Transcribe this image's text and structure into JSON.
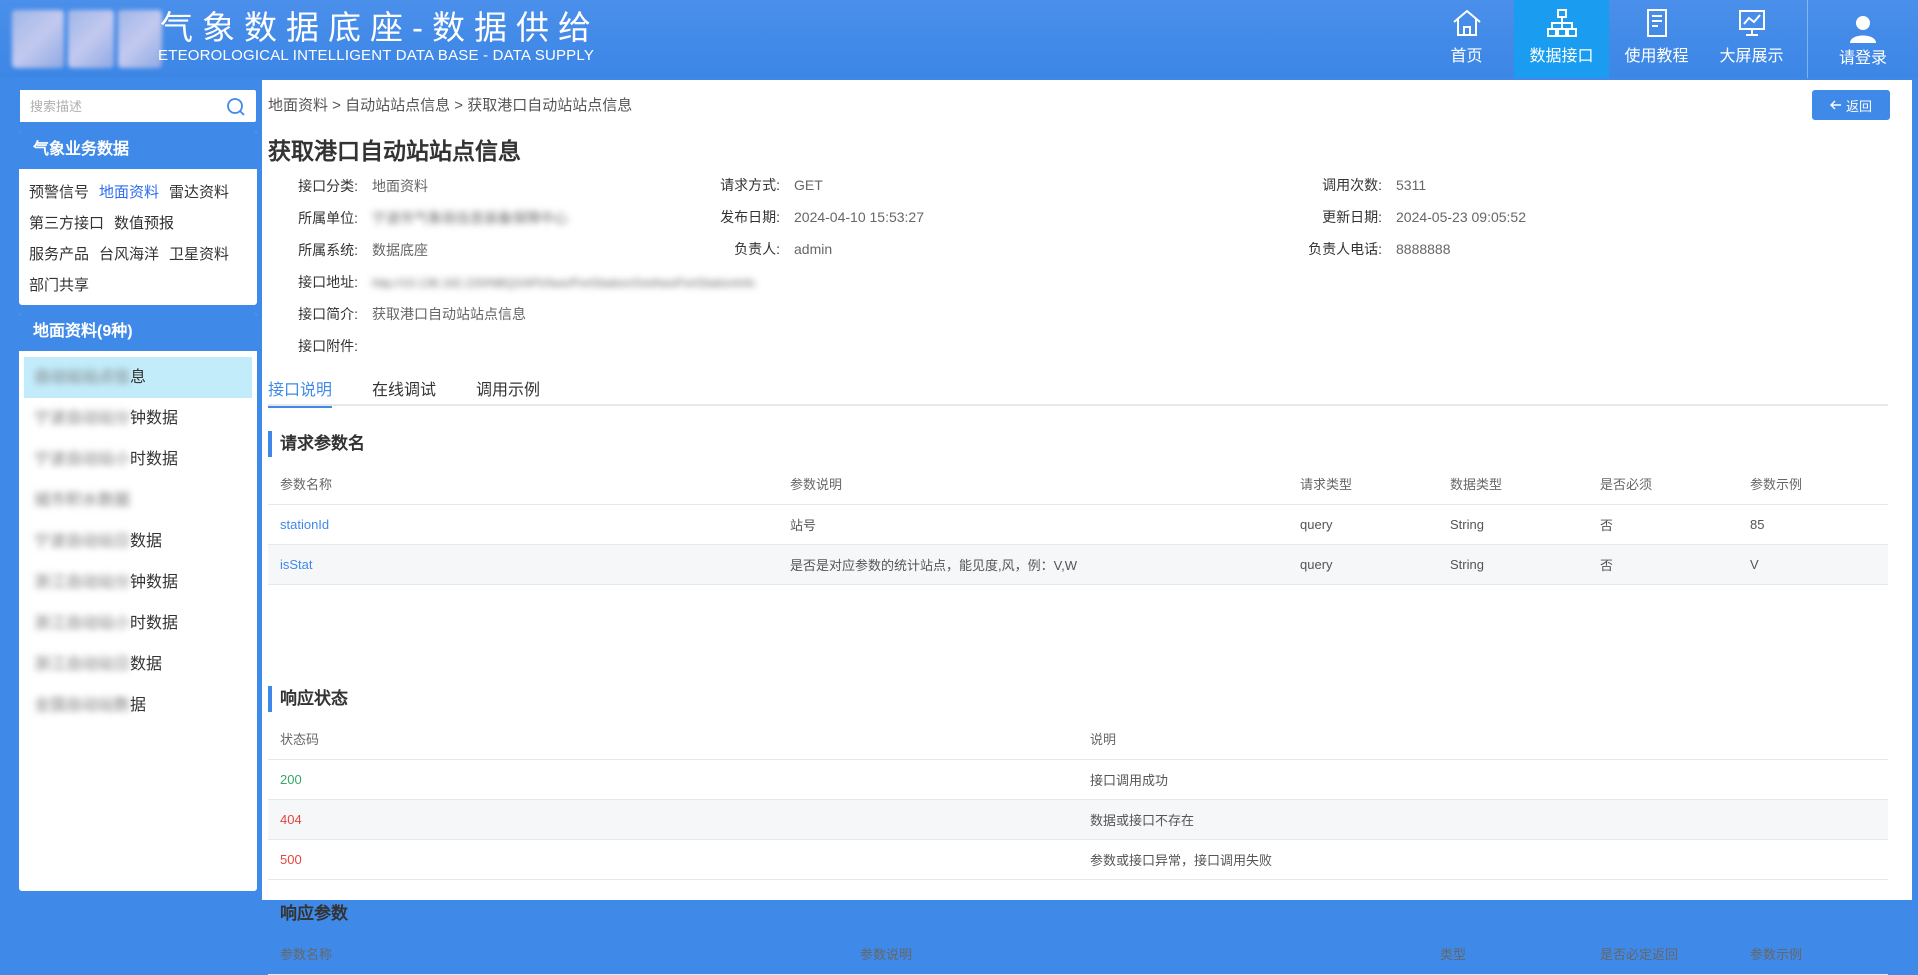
{
  "header": {
    "title_cn": "气象数据底座-数据供给",
    "title_en": "ETEOROLOGICAL INTELLIGENT DATA BASE - DATA SUPPLY",
    "nav": [
      {
        "label": "首页",
        "icon": "home-icon"
      },
      {
        "label": "数据接口",
        "icon": "sitemap-icon",
        "active": true
      },
      {
        "label": "使用教程",
        "icon": "document-icon"
      },
      {
        "label": "大屏展示",
        "icon": "chart-screen-icon"
      }
    ],
    "login_label": "请登录"
  },
  "sidebar": {
    "search_placeholder": "搜索描述",
    "categories_title": "气象业务数据",
    "categories": [
      "预警信号",
      "地面资料",
      "雷达资料",
      "第三方接口",
      "数值预报",
      "服务产品",
      "台风海洋",
      "卫星资料",
      "部门共享"
    ],
    "active_category": "地面资料",
    "list_title": "地面资料(9种)",
    "list_items": [
      {
        "blurred": "自动站站点信",
        "label": "息"
      },
      {
        "blurred": "宁波自动站分",
        "label": "钟数据"
      },
      {
        "blurred": "宁波自动站小",
        "label": "时数据"
      },
      {
        "blurred": "城市积水数据",
        "label": ""
      },
      {
        "blurred": "宁波自动站日",
        "label": "数据"
      },
      {
        "blurred": "浙江自动站分",
        "label": "钟数据"
      },
      {
        "blurred": "浙江自动站小",
        "label": "时数据"
      },
      {
        "blurred": "浙江自动站日",
        "label": "数据"
      },
      {
        "blurred": "全国自动站数",
        "label": "据"
      }
    ]
  },
  "main": {
    "breadcrumb": "地面资料 > 自动站站点信息 > 获取港口自动站站点信息",
    "back_label": "返回",
    "title": "获取港口自动站站点信息",
    "info": {
      "category_label": "接口分类:",
      "category": "地面资料",
      "unit_label": "所属单位:",
      "unit": "宁波市气象局信息装备保障中心",
      "system_label": "所属系统:",
      "system": "数据底座",
      "address_label": "接口地址:",
      "address": "http://10.136.162.220/NBQXAPI/Aws/PortStation/GetAwsPortStationInfo",
      "intro_label": "接口简介:",
      "intro": "获取港口自动站站点信息",
      "attachment_label": "接口附件:",
      "method_label": "请求方式:",
      "method": "GET",
      "publish_label": "发布日期:",
      "publish": "2024-04-10 15:53:27",
      "owner_label": "负责人:",
      "owner": "admin",
      "calls_label": "调用次数:",
      "calls": "5311",
      "update_label": "更新日期:",
      "update": "2024-05-23 09:05:52",
      "phone_label": "负责人电话:",
      "phone": "8888888"
    },
    "tabs": [
      "接口说明",
      "在线调试",
      "调用示例"
    ],
    "request_section": "请求参数名",
    "request_headers": [
      "参数名称",
      "参数说明",
      "请求类型",
      "数据类型",
      "是否必须",
      "参数示例"
    ],
    "request_rows": [
      [
        "stationId",
        "站号",
        "query",
        "String",
        "否",
        "85"
      ],
      [
        "isStat",
        "是否是对应参数的统计站点，能见度,风，例：V,W",
        "query",
        "String",
        "否",
        "V"
      ]
    ],
    "status_section": "响应状态",
    "status_headers": [
      "状态码",
      "说明"
    ],
    "status_rows": [
      [
        "200",
        "接口调用成功"
      ],
      [
        "404",
        "数据或接口不存在"
      ],
      [
        "500",
        "参数或接口异常，接口调用失败"
      ]
    ],
    "response_section": "响应参数",
    "response_headers": [
      "参数名称",
      "参数说明",
      "类型",
      "是否必定返回",
      "参数示例"
    ]
  },
  "colors": {
    "primary": "#3f8ae8",
    "active_nav": "#1a9df0",
    "success": "#3aa56a",
    "error": "#e2473c"
  }
}
